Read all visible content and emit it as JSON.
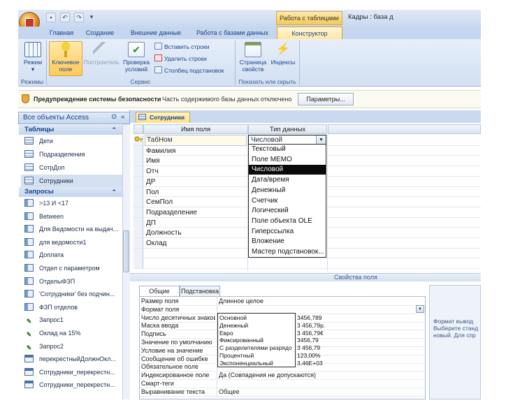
{
  "window": {
    "title": "Кадры : база д",
    "context_tab": "Работа с таблицами"
  },
  "ribbon_tabs": [
    "Главная",
    "Создание",
    "Внешние данные",
    "Работа с базами данных",
    "Конструктор"
  ],
  "ribbon": {
    "mode_label": "Режим",
    "key_field": [
      "Ключевое",
      "поле"
    ],
    "builder": "Построитель",
    "check_conditions": [
      "Проверка",
      "условий"
    ],
    "insert_rows": "Вставить строки",
    "delete_rows": "Удалить строки",
    "lookup_column": "Столбец подстановок",
    "property_sheet": [
      "Страница",
      "свойств"
    ],
    "indexes": "Индексы",
    "groups": {
      "modes": "Режимы",
      "service": "Сервис",
      "show_hide": "Показать или скрыть"
    }
  },
  "security_bar": {
    "warning": "Предупреждение системы безопасности",
    "message": "Часть содержимого базы данных отключено",
    "params_button": "Параметры..."
  },
  "nav": {
    "title": "Все объекты Access",
    "tables_header": "Таблицы",
    "tables": [
      "Дети",
      "Подразделения",
      "СотрДоп",
      "Сотрудники"
    ],
    "queries_header": "Запросы",
    "queries": [
      ">13 И <17",
      "Between",
      "Для Ведомости на выдач...",
      "для ведомости1",
      "Доплата",
      "Отдел с параметром",
      "ОтделыФЗП",
      "'Сотрудники' без подчин...",
      "ФЗП отделов",
      "Запрос1",
      "Оклад на 15%",
      "Запрос2",
      "перекрестныйДолжнОкл...",
      "Сотрудники_перекрестн...",
      "Сотрудники_перекрестн..."
    ]
  },
  "doc_tab": "Сотрудники",
  "grid": {
    "col_name": "Имя поля",
    "col_type": "Тип данных",
    "fields": [
      "ТабНом",
      "Фамилия",
      "Имя",
      "Отч",
      "ДР",
      "Пол",
      "СемПол",
      "Подразделение",
      "ДП",
      "Должность",
      "Оклад"
    ],
    "current_type": "Числовой",
    "type_options": [
      "Текстовый",
      "Поле MEMO",
      "Числовой",
      "Дата/время",
      "Денежный",
      "Счетчик",
      "Логический",
      "Поле объекта OLE",
      "Гиперссылка",
      "Вложение",
      "Мастер подстановок..."
    ],
    "highlighted_option": "Числовой"
  },
  "props": {
    "header": "Свойства поля",
    "tabs": [
      "Общие",
      "Подстановка"
    ],
    "rows": [
      {
        "label": "Размер поля",
        "value": "Длинное целое"
      },
      {
        "label": "Формат поля",
        "value": ""
      },
      {
        "label": "Число десятичных знаков",
        "value": ""
      },
      {
        "label": "Маска ввода",
        "value": ""
      },
      {
        "label": "Подпись",
        "value": ""
      },
      {
        "label": "Значение по умолчанию",
        "value": ""
      },
      {
        "label": "Условие на значение",
        "value": ""
      },
      {
        "label": "Сообщение об ошибке",
        "value": ""
      },
      {
        "label": "Обязательное поле",
        "value": ""
      },
      {
        "label": "Индексированное поле",
        "value": "Да (Совпадения не допускаются)"
      },
      {
        "label": "Смарт-теги",
        "value": ""
      },
      {
        "label": "Выравнивание текста",
        "value": "Общее"
      }
    ],
    "format_options": [
      {
        "name": "Основной",
        "sample": "3456,789"
      },
      {
        "name": "Денежный",
        "sample": "3 456,79р."
      },
      {
        "name": "Евро",
        "sample": "3 456,79€"
      },
      {
        "name": "Фиксированный",
        "sample": "3456,79"
      },
      {
        "name": "С разделителями разрядо",
        "sample": "3 456,79"
      },
      {
        "name": "Процентный",
        "sample": "123,00%"
      },
      {
        "name": "Экспоненциальный",
        "sample": "3,46E+03"
      }
    ],
    "hint": "Формат вывод Выберите станд новый. Для спр"
  }
}
